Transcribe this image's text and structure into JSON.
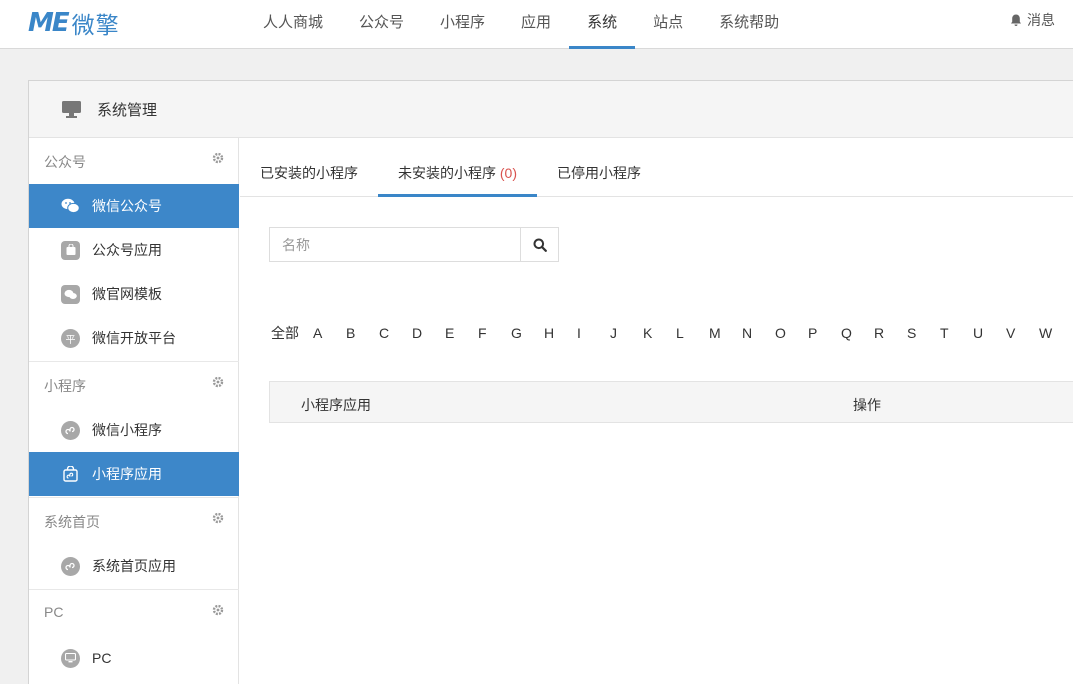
{
  "brand": {
    "mark": "ME",
    "name": "微擎"
  },
  "nav": {
    "items": [
      {
        "label": "人人商城"
      },
      {
        "label": "公众号"
      },
      {
        "label": "小程序"
      },
      {
        "label": "应用"
      },
      {
        "label": "系统",
        "active": true
      },
      {
        "label": "站点"
      },
      {
        "label": "系统帮助"
      }
    ],
    "message_label": "消息"
  },
  "panel": {
    "title": "系统管理"
  },
  "sidebar": {
    "groups": [
      {
        "label": "公众号",
        "items": [
          {
            "label": "微信公众号",
            "icon": "wechat-icon",
            "active": true
          },
          {
            "label": "公众号应用",
            "icon": "app-bag-icon"
          },
          {
            "label": "微官网模板",
            "icon": "wechat-template-icon"
          },
          {
            "label": "微信开放平台",
            "icon": "open-platform-icon",
            "glyph": "平"
          }
        ]
      },
      {
        "label": "小程序",
        "items": [
          {
            "label": "微信小程序",
            "icon": "miniprogram-icon"
          },
          {
            "label": "小程序应用",
            "icon": "miniprogram-app-icon",
            "active": true
          }
        ]
      },
      {
        "label": "系统首页",
        "items": [
          {
            "label": "系统首页应用",
            "icon": "miniprogram-icon"
          }
        ]
      },
      {
        "label": "PC",
        "items": [
          {
            "label": "PC",
            "icon": "monitor-icon"
          }
        ]
      }
    ]
  },
  "tabs": [
    {
      "label": "已安装的小程序"
    },
    {
      "label": "未安装的小程序",
      "count": "(0)",
      "active": true
    },
    {
      "label": "已停用小程序"
    }
  ],
  "search": {
    "placeholder": "名称",
    "value": ""
  },
  "letters": [
    "全部",
    "A",
    "B",
    "C",
    "D",
    "E",
    "F",
    "G",
    "H",
    "I",
    "J",
    "K",
    "L",
    "M",
    "N",
    "O",
    "P",
    "Q",
    "R",
    "S",
    "T",
    "U",
    "V",
    "W"
  ],
  "table": {
    "columns": [
      "小程序应用",
      "操作"
    ]
  },
  "colors": {
    "accent": "#3a86c8",
    "active_bg": "#3d87c9",
    "count": "#d9534f"
  }
}
